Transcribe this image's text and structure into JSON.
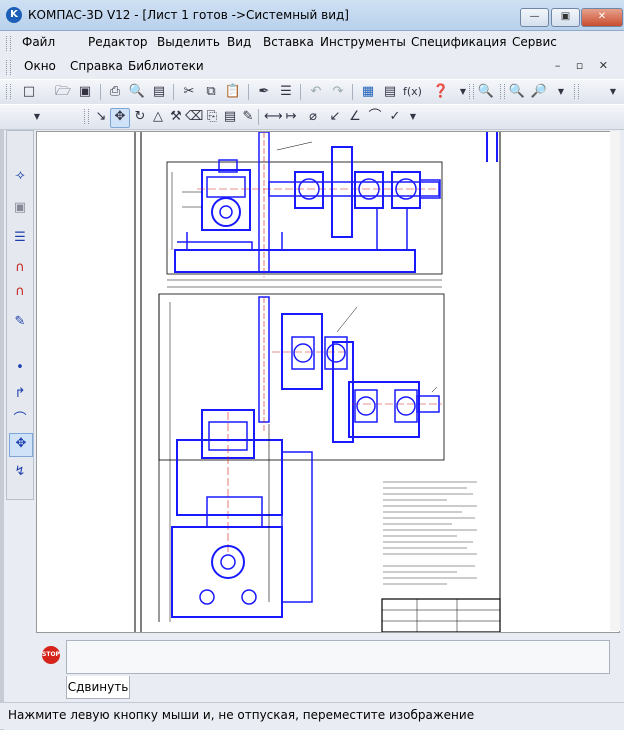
{
  "window": {
    "title": "КОМПАС-3D V12 - [Лист 1 готов ->Системный вид]",
    "app_icon_label": "K"
  },
  "menu": {
    "row1": [
      "Файл",
      "Редактор",
      "Выделить",
      "Вид",
      "Вставка",
      "Инструменты",
      "Спецификация",
      "Сервис"
    ],
    "row2": [
      "Окно",
      "Справка",
      "Библиотеки"
    ]
  },
  "parameter_panel": {
    "stop_label": "STOP",
    "tab_label": "Сдвинуть"
  },
  "status": {
    "text": "Нажмите левую кнопку мыши и, не отпуская, переместите изображение"
  },
  "colors": {
    "drawing_blue": "#1a1aff",
    "drawing_black": "#000000",
    "accent_red": "#d5241c"
  }
}
